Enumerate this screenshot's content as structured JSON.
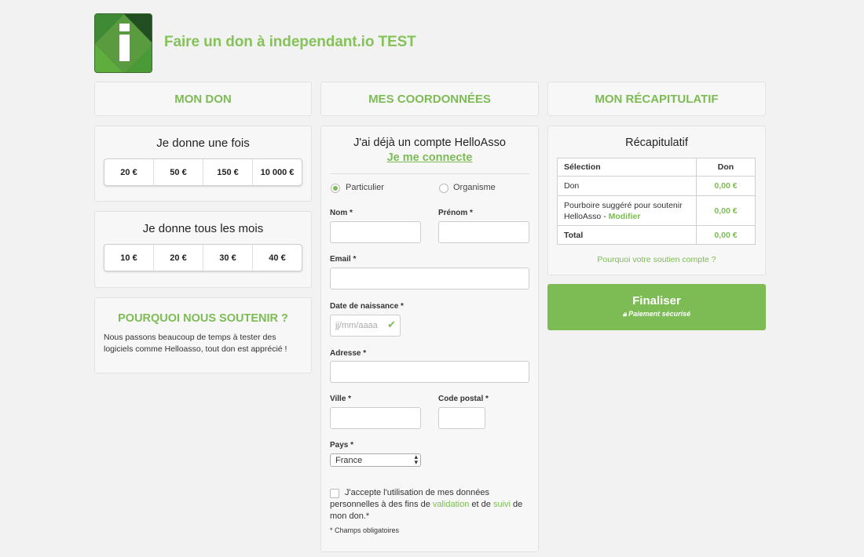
{
  "header": {
    "title": "Faire un don à independant.io TEST"
  },
  "columns": {
    "don": "MON DON",
    "coordonnees": "MES COORDONNÉES",
    "recap": "MON RÉCAPITULATIF"
  },
  "once": {
    "title": "Je donne une fois",
    "amounts": [
      "20 €",
      "50 €",
      "150 €",
      "10 000 €"
    ]
  },
  "monthly": {
    "title": "Je donne tous les mois",
    "amounts": [
      "10 €",
      "20 €",
      "30 €",
      "40 €"
    ]
  },
  "why": {
    "title": "POURQUOI NOUS SOUTENIR ?",
    "text": "Nous passons beaucoup de temps à tester des logiciels comme Helloasso, tout don est apprécié !"
  },
  "account": {
    "text": "J'ai déjà un compte HelloAsso",
    "link": "Je me connecte"
  },
  "form": {
    "radio_particulier": "Particulier",
    "radio_organisme": "Organisme",
    "nom": "Nom *",
    "prenom": "Prénom *",
    "email": "Email *",
    "birth": "Date de naissance *",
    "birth_placeholder": "jj/mm/aaaa",
    "adresse": "Adresse *",
    "ville": "Ville *",
    "cp": "Code postal *",
    "pays": "Pays *",
    "pays_value": "France",
    "consent_a": "J'accepte l'utilisation de mes données personnelles à des fins de",
    "consent_validation": "validation",
    "consent_et": "et de",
    "consent_suivi": "suivi",
    "consent_b": "de mon don.*",
    "required": "* Champs obligatoires"
  },
  "recap": {
    "title": "Récapitulatif",
    "col_selection": "Sélection",
    "col_don": "Don",
    "row_don": "Don",
    "row_don_amt": "0,00 €",
    "row_tip": "Pourboire suggéré pour soutenir HelloAsso -",
    "row_tip_link": "Modifier",
    "row_tip_amt": "0,00 €",
    "row_total": "Total",
    "row_total_amt": "0,00 €",
    "why_link": "Pourquoi votre soutien compte ?"
  },
  "finalize": {
    "label": "Finaliser",
    "sub": "Paiement sécurisé",
    "color": "#7dbb55"
  }
}
